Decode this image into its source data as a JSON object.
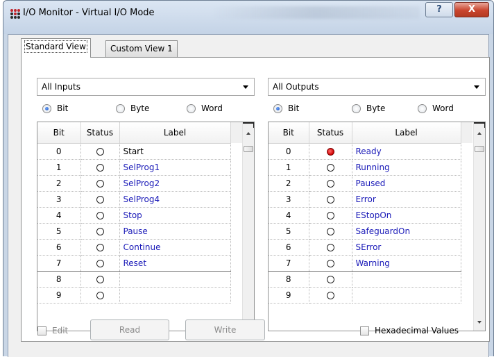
{
  "window": {
    "title": "I/O Monitor - Virtual I/O Mode",
    "help_glyph": "?",
    "close_glyph": "X"
  },
  "tabs": [
    {
      "label": "Standard View",
      "active": true
    },
    {
      "label": "Custom View 1",
      "active": false
    }
  ],
  "inputs": {
    "selector": "All Inputs",
    "radio": [
      {
        "label": "Bit",
        "checked": true
      },
      {
        "label": "Byte",
        "checked": false
      },
      {
        "label": "Word",
        "checked": false
      }
    ],
    "columns": [
      "Bit",
      "Status",
      "Label"
    ],
    "rows": [
      {
        "bit": "0",
        "on": false,
        "label": "Start"
      },
      {
        "bit": "1",
        "on": false,
        "label": "SelProg1"
      },
      {
        "bit": "2",
        "on": false,
        "label": "SelProg2"
      },
      {
        "bit": "3",
        "on": false,
        "label": "SelProg4"
      },
      {
        "bit": "4",
        "on": false,
        "label": "Stop"
      },
      {
        "bit": "5",
        "on": false,
        "label": "Pause"
      },
      {
        "bit": "6",
        "on": false,
        "label": "Continue"
      },
      {
        "bit": "7",
        "on": false,
        "label": "Reset"
      },
      {
        "bit": "8",
        "on": false,
        "label": ""
      },
      {
        "bit": "9",
        "on": false,
        "label": ""
      }
    ]
  },
  "outputs": {
    "selector": "All Outputs",
    "radio": [
      {
        "label": "Bit",
        "checked": true
      },
      {
        "label": "Byte",
        "checked": false
      },
      {
        "label": "Word",
        "checked": false
      }
    ],
    "columns": [
      "Bit",
      "Status",
      "Label"
    ],
    "rows": [
      {
        "bit": "0",
        "on": true,
        "label": "Ready"
      },
      {
        "bit": "1",
        "on": false,
        "label": "Running"
      },
      {
        "bit": "2",
        "on": false,
        "label": "Paused"
      },
      {
        "bit": "3",
        "on": false,
        "label": "Error"
      },
      {
        "bit": "4",
        "on": false,
        "label": "EStopOn"
      },
      {
        "bit": "5",
        "on": false,
        "label": "SafeguardOn"
      },
      {
        "bit": "6",
        "on": false,
        "label": "SError"
      },
      {
        "bit": "7",
        "on": false,
        "label": "Warning"
      },
      {
        "bit": "8",
        "on": false,
        "label": ""
      },
      {
        "bit": "9",
        "on": false,
        "label": ""
      }
    ]
  },
  "footer": {
    "edit_label": "Edit",
    "read_label": "Read",
    "write_label": "Write",
    "hex_label": "Hexadecimal Values"
  },
  "colors": {
    "label_text": "#1a1ab8",
    "status_on": "#d10000"
  }
}
